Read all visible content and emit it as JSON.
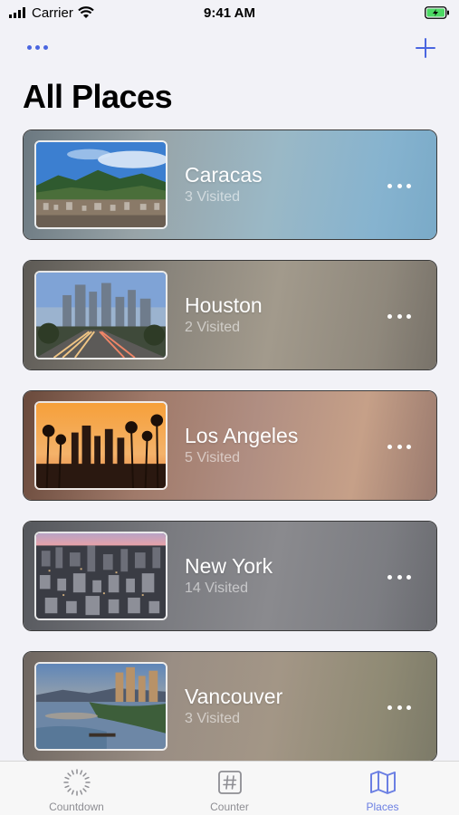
{
  "status_bar": {
    "carrier": "Carrier",
    "time": "9:41 AM"
  },
  "header": {
    "title": "All Places"
  },
  "places": [
    {
      "name": "Caracas",
      "visited": "3 Visited"
    },
    {
      "name": "Houston",
      "visited": "2 Visited"
    },
    {
      "name": "Los Angeles",
      "visited": "5 Visited"
    },
    {
      "name": "New York",
      "visited": "14 Visited"
    },
    {
      "name": "Vancouver",
      "visited": "3 Visited"
    }
  ],
  "tabs": [
    {
      "label": "Countdown",
      "icon": "countdown-icon",
      "active": false
    },
    {
      "label": "Counter",
      "icon": "hash-icon",
      "active": false
    },
    {
      "label": "Places",
      "icon": "map-icon",
      "active": true
    }
  ],
  "colors": {
    "accent": "#4a66e0",
    "tab_active": "#6b7fe3",
    "tab_inactive": "#8e8e93",
    "battery": "#4cd964"
  }
}
